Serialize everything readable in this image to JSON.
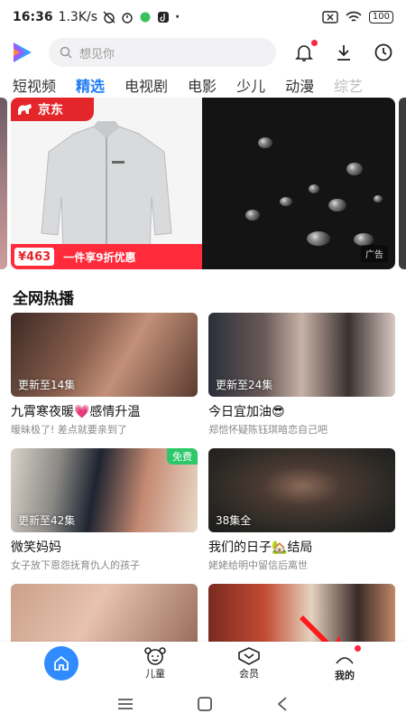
{
  "status": {
    "time": "16:36",
    "speed": "1.3K/s",
    "battery": "100"
  },
  "search": {
    "placeholder": "想见你"
  },
  "tabs": [
    {
      "label": "短视频"
    },
    {
      "label": "精选"
    },
    {
      "label": "电视剧"
    },
    {
      "label": "电影"
    },
    {
      "label": "少儿"
    },
    {
      "label": "动漫"
    },
    {
      "label": "综艺"
    }
  ],
  "banner": {
    "brand": "京东",
    "price": "¥463",
    "promo": "一件享9折优惠",
    "ad_label": "广告"
  },
  "section": {
    "title": "全网热播"
  },
  "items": [
    {
      "badge": "更新至14集",
      "title": "九霄寒夜暖💗感情升温",
      "sub": "暧昧极了! 差点就要亲到了",
      "free": ""
    },
    {
      "badge": "更新至24集",
      "title": "今日宜加油😎",
      "sub": "郑恺怀疑陈钰琪暗恋自己吧",
      "free": ""
    },
    {
      "badge": "更新至42集",
      "title": "微笑妈妈",
      "sub": "女子放下恩怨抚育仇人的孩子",
      "free": "免费"
    },
    {
      "badge": "38集全",
      "title": "我们的日子🏡结局",
      "sub": "姥姥给明中留信后离世",
      "free": ""
    }
  ],
  "nav": [
    {
      "label": ""
    },
    {
      "label": "儿童"
    },
    {
      "label": "会员"
    },
    {
      "label": "我的"
    }
  ],
  "colors": {
    "accent": "#1f7cf0",
    "brand_red": "#e4262b",
    "home_blue": "#2f8bff"
  }
}
